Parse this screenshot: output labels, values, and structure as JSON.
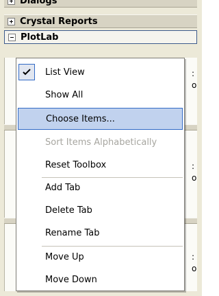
{
  "toolbox": {
    "groups": [
      {
        "label": "Dialogs",
        "expander": "+"
      },
      {
        "label": "Crystal Reports",
        "expander": "+"
      },
      {
        "label": "PlotLab",
        "expander": "-"
      }
    ]
  },
  "context_menu": {
    "items": [
      {
        "label": "List View",
        "checked": true,
        "enabled": true
      },
      {
        "label": "Show All",
        "enabled": true
      },
      {
        "label": "Choose Items...",
        "enabled": true,
        "highlighted": true
      },
      {
        "label": "Sort Items Alphabetically",
        "enabled": false
      },
      {
        "label": "Reset Toolbox",
        "enabled": true
      },
      {
        "label": "Add Tab",
        "enabled": true
      },
      {
        "label": "Delete Tab",
        "enabled": true
      },
      {
        "label": "Rename Tab",
        "enabled": true
      },
      {
        "label": "Move Up",
        "enabled": true
      },
      {
        "label": "Move Down",
        "enabled": true
      }
    ]
  }
}
